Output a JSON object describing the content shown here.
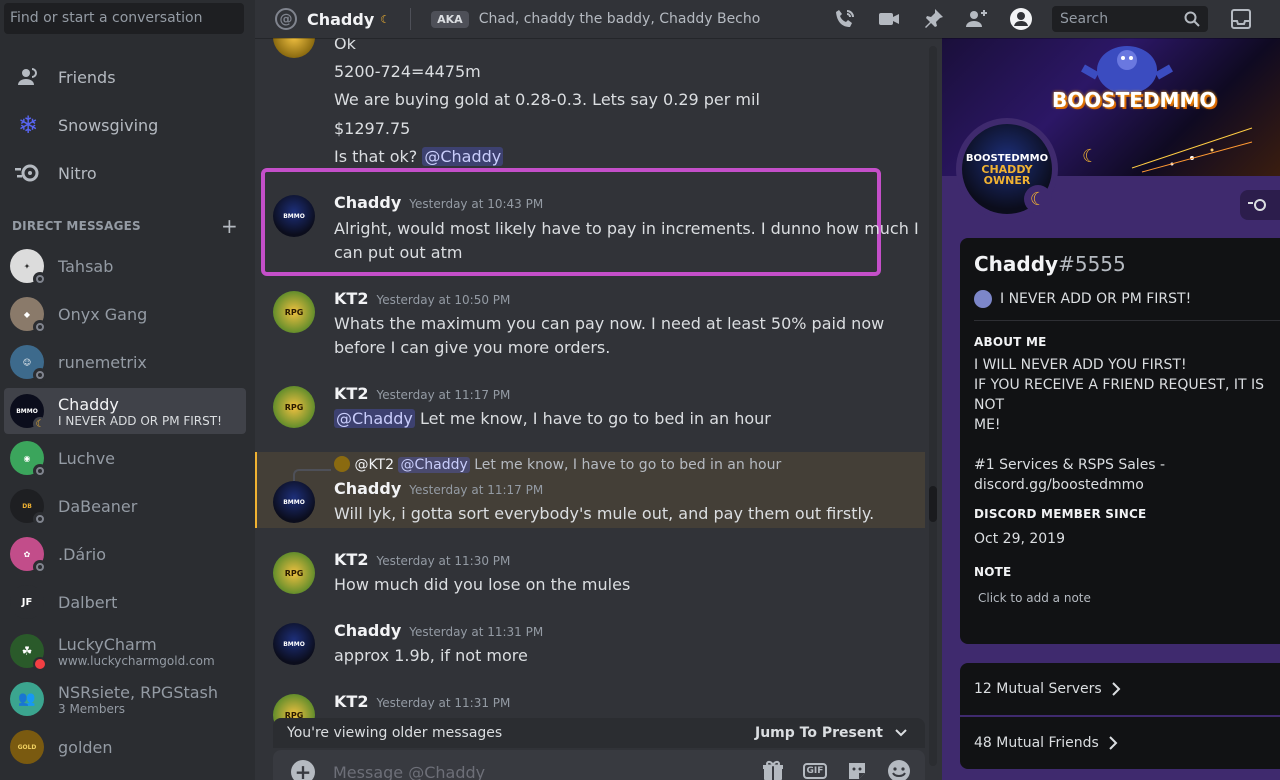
{
  "sidebar": {
    "search_placeholder": "Find or start a conversation",
    "nav": [
      {
        "label": "Friends",
        "icon": "friends-icon"
      },
      {
        "label": "Snowsgiving",
        "icon": "snowflake-icon"
      },
      {
        "label": "Nitro",
        "icon": "nitro-icon"
      }
    ],
    "dm_header": "DIRECT MESSAGES",
    "dms": [
      {
        "name": "Tahsab",
        "sub": "",
        "status": "offline"
      },
      {
        "name": "Onyx Gang",
        "sub": "",
        "status": "offline"
      },
      {
        "name": "runemetrix",
        "sub": "",
        "status": "offline"
      },
      {
        "name": "Chaddy",
        "sub": "I NEVER ADD OR PM FIRST!",
        "status": "idle",
        "active": true
      },
      {
        "name": "Luchve",
        "sub": "",
        "status": "offline"
      },
      {
        "name": "DaBeaner",
        "sub": "",
        "status": "offline"
      },
      {
        "name": ".Dário",
        "sub": "",
        "status": "offline"
      },
      {
        "name": "Dalbert",
        "sub": "",
        "status": "offline"
      },
      {
        "name": "LuckyCharm",
        "sub": "www.luckycharmgold.com",
        "status": "dnd"
      },
      {
        "name": "NSRsiete, RPGStash",
        "sub": "3 Members",
        "status": "group"
      },
      {
        "name": "golden",
        "sub": "",
        "status": "offline"
      }
    ]
  },
  "topbar": {
    "channel": "Chaddy",
    "aka_label": "AKA",
    "aka_names": "Chad, chaddy the baddy, Chaddy Becho",
    "search_placeholder": "Search"
  },
  "chat": {
    "top_lines": [
      "Ok",
      "5200-724=4475m",
      "We are buying gold at 0.28-0.3. Lets say 0.29 per mil",
      "$1297.75"
    ],
    "top_last_text": "Is that ok?",
    "top_last_mention": "@Chaddy",
    "messages": [
      {
        "author": "Chaddy",
        "time": "Yesterday at 10:43 PM",
        "lines": [
          "Alright, would most likely have to pay in increments. I dunno how much I",
          "can put out atm"
        ]
      },
      {
        "author": "KT2",
        "time": "Yesterday at 10:50 PM",
        "lines": [
          "Whats the maximum you can pay now. I need at least 50% paid now",
          "before I can give you more orders."
        ]
      },
      {
        "author": "KT2",
        "time": "Yesterday at 11:17 PM",
        "mention": "@Chaddy",
        "text": "Let me know, I have to go to bed in an hour"
      },
      {
        "author": "Chaddy",
        "time": "Yesterday at 11:17 PM",
        "reply_author": "@KT2",
        "reply_mention": "@Chaddy",
        "reply_text": "Let me know, I have to go to bed in an hour",
        "lines": [
          "Will lyk, i gotta sort everybody's mule out, and pay them out firstly."
        ]
      },
      {
        "author": "KT2",
        "time": "Yesterday at 11:30 PM",
        "lines": [
          "How much did you lose on the mules"
        ]
      },
      {
        "author": "Chaddy",
        "time": "Yesterday at 11:31 PM",
        "lines": [
          "approx 1.9b, if not more"
        ]
      },
      {
        "author": "KT2",
        "time": "Yesterday at 11:31 PM",
        "lines": []
      }
    ],
    "older_notice": "You're viewing older messages",
    "jump_label": "Jump To Present",
    "composer_placeholder": "Message @Chaddy"
  },
  "profile": {
    "banner_text": "BOOSTEDMMO",
    "avatar_lines": [
      "BOOSTEDMMO",
      "CHADDY",
      "OWNER"
    ],
    "username": "Chaddy",
    "discriminator": "#5555",
    "custom_status": "I NEVER ADD OR PM FIRST!",
    "about_header": "ABOUT ME",
    "about_text": "I WILL NEVER ADD YOU FIRST!\nIF YOU RECEIVE A FRIEND REQUEST, IT IS NOT\nME!\n\n#1 Services & RSPS Sales -\ndiscord.gg/boostedmmo",
    "member_since_header": "DISCORD MEMBER SINCE",
    "member_since": "Oct 29, 2019",
    "note_header": "NOTE",
    "note_placeholder": "Click to add a note",
    "mutual_servers": "12 Mutual Servers",
    "mutual_friends": "48 Mutual Friends"
  },
  "colors": {
    "highlight": "#c44fc9",
    "mention_bg": "#3c4270",
    "idle": "#f0b232",
    "dnd": "#f23f43"
  }
}
